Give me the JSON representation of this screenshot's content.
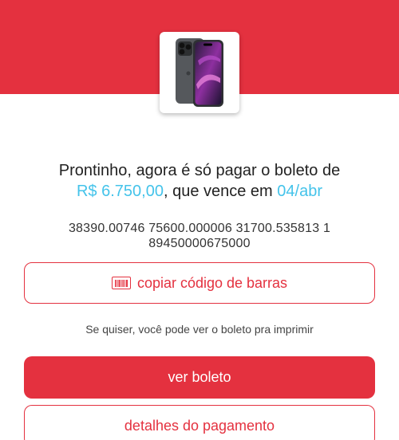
{
  "header": {
    "background_color": "#e4313f",
    "product_image": "phone-image"
  },
  "message": {
    "text_before": "Prontinho, agora é só pagar o boleto de",
    "amount": "R$ 6.750,00",
    "text_middle": ", que vence em",
    "due_date": "04/abr",
    "highlight_color": "#44c3ea"
  },
  "barcode": {
    "line1": "38390.00746  75600.000006  31700.535813  1",
    "line2": "89450000675000"
  },
  "actions": {
    "copy_label": "copiar código de barras",
    "copy_icon": "barcode-icon",
    "hint": "Se quiser, você pode ver o boleto pra imprimir",
    "view_label": "ver boleto",
    "details_label": "detalhes do pagamento"
  }
}
